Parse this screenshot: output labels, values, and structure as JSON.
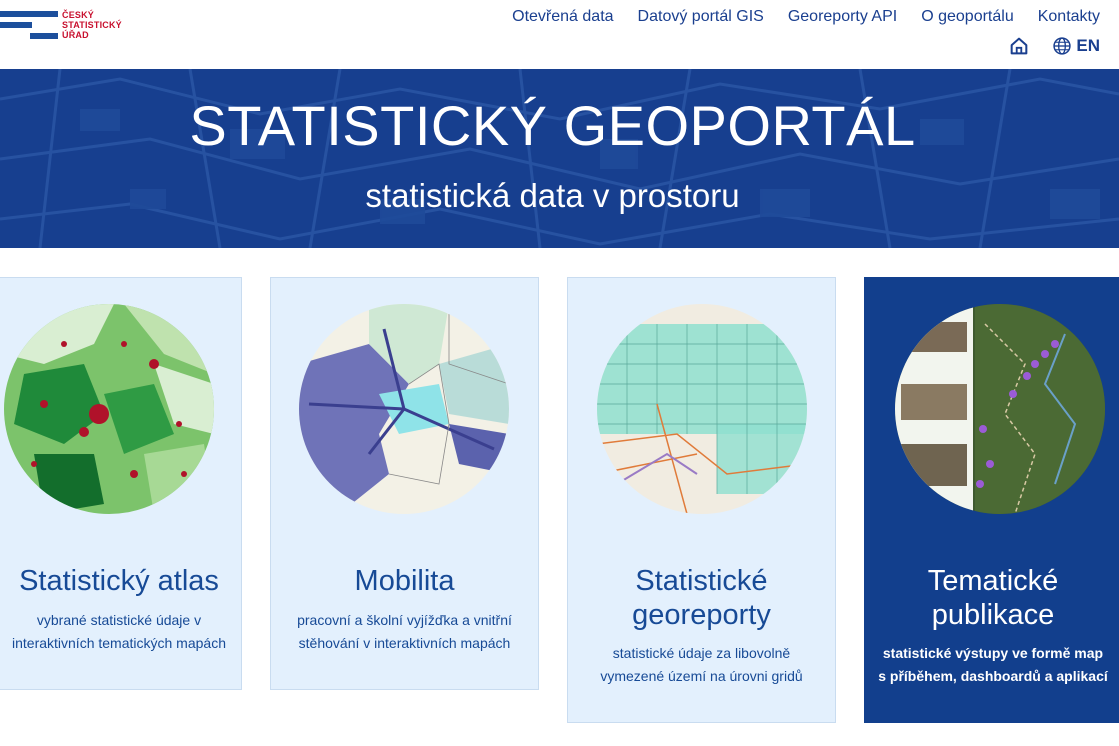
{
  "logo": {
    "line1": "ČESKÝ",
    "line2": "STATISTICKÝ",
    "line3": "ÚŘAD"
  },
  "nav": {
    "items": [
      "Otevřená data",
      "Datový portál GIS",
      "Georeporty API",
      "O geoportálu",
      "Kontakty"
    ],
    "lang_label": "EN"
  },
  "hero": {
    "title": "STATISTICKÝ GEOPORTÁL",
    "subtitle": "statistická data v prostoru"
  },
  "cards": [
    {
      "title": "Statistický atlas",
      "desc1": "vybrané statistické údaje v",
      "desc2": "interaktivních tematických mapách"
    },
    {
      "title": "Mobilita",
      "desc1": "pracovní a školní vyjížďka a vnitřní",
      "desc2": "stěhování v interaktivních mapách"
    },
    {
      "title1": "Statistické",
      "title2": "georeporty",
      "desc1": "statistické údaje za libovolně",
      "desc2": "vymezené území na úrovni gridů"
    },
    {
      "title1": "Tematické",
      "title2": "publikace",
      "desc1": "statistické výstupy ve formě map",
      "desc2": "s příběhem, dashboardů a aplikací"
    }
  ],
  "colors": {
    "brand_blue": "#173f8f",
    "card_bg": "#e3f0fd",
    "logo_red": "#c8102e"
  },
  "icons": [
    "home-icon",
    "globe-icon"
  ]
}
